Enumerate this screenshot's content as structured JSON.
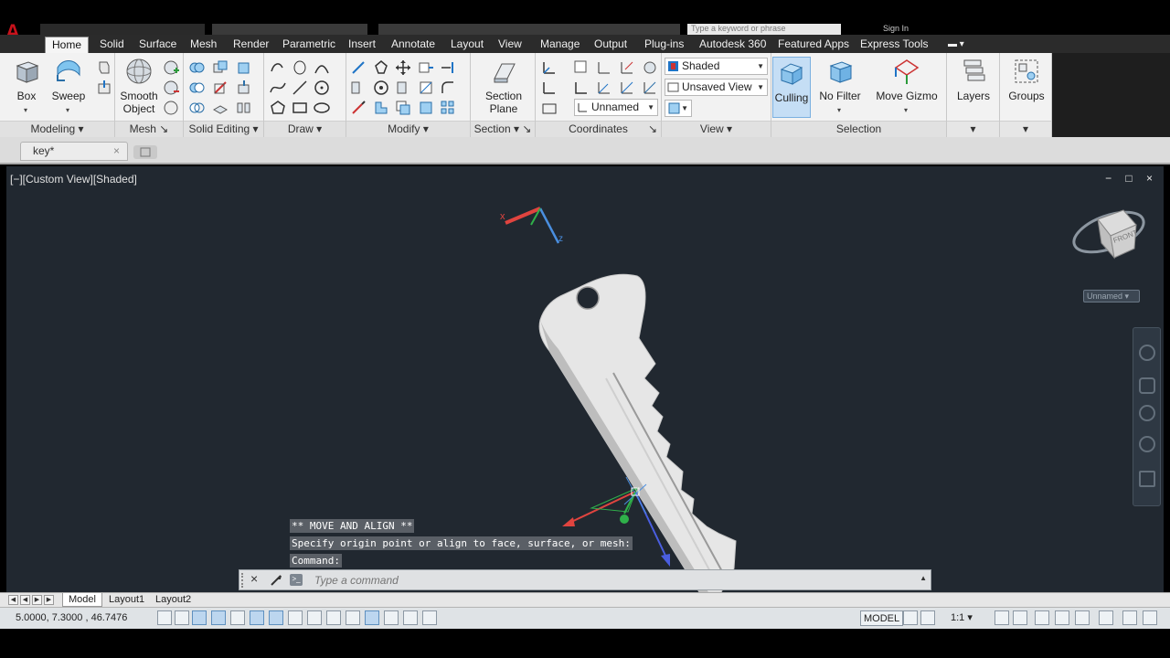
{
  "titlebar": {
    "search_placeholder": "Type a keyword or phrase",
    "signin": "Sign In"
  },
  "ribbon_tabs": [
    "Home",
    "Solid",
    "Surface",
    "Mesh",
    "Render",
    "Parametric",
    "Insert",
    "Annotate",
    "Layout",
    "View",
    "Manage",
    "Output",
    "Plug-ins",
    "Autodesk 360",
    "Featured Apps",
    "Express Tools"
  ],
  "active_tab": "Home",
  "panels": {
    "modeling": {
      "title": "Modeling",
      "box": "Box",
      "sweep": "Sweep",
      "smooth_object": "Smooth Object"
    },
    "mesh": {
      "title": "Mesh"
    },
    "solid_editing": {
      "title": "Solid Editing"
    },
    "draw": {
      "title": "Draw"
    },
    "modify": {
      "title": "Modify"
    },
    "section": {
      "title": "Section",
      "section_plane": "Section Plane"
    },
    "coordinates": {
      "title": "Coordinates",
      "ucs_dropdown": "Unnamed"
    },
    "view": {
      "title": "View",
      "visual_style": "Shaded",
      "named_view": "Unsaved View"
    },
    "selection": {
      "title": "Selection",
      "culling": "Culling",
      "no_filter": "No Filter",
      "move_gizmo": "Move Gizmo"
    },
    "layers": {
      "label": "Layers"
    },
    "groups": {
      "label": "Groups"
    }
  },
  "file_tab": {
    "name": "key*"
  },
  "viewport": {
    "label": "[−][Custom View][Shaded]",
    "controls": "− □ ×",
    "ucs_badge": "Unnamed",
    "viewcube_face": "FRONT"
  },
  "command": {
    "history": [
      "** MOVE AND ALIGN **",
      "Specify origin point or align to face, surface, or mesh:",
      "Command:"
    ],
    "placeholder": "Type a command"
  },
  "layout_tabs": [
    "Model",
    "Layout1",
    "Layout2"
  ],
  "status": {
    "coords": "5.0000, 7.3000 , 46.7476",
    "model": "MODEL",
    "scale": "1:1"
  },
  "colors": {
    "viewport_bg": "#212830",
    "key_fill": "#e6e6e6",
    "ribbon_bg": "#f2f2f2",
    "accent_blue": "#1f74c6",
    "gizmo_red": "#e0443f",
    "gizmo_green": "#2fb14a",
    "gizmo_blue": "#4a5ee0"
  }
}
